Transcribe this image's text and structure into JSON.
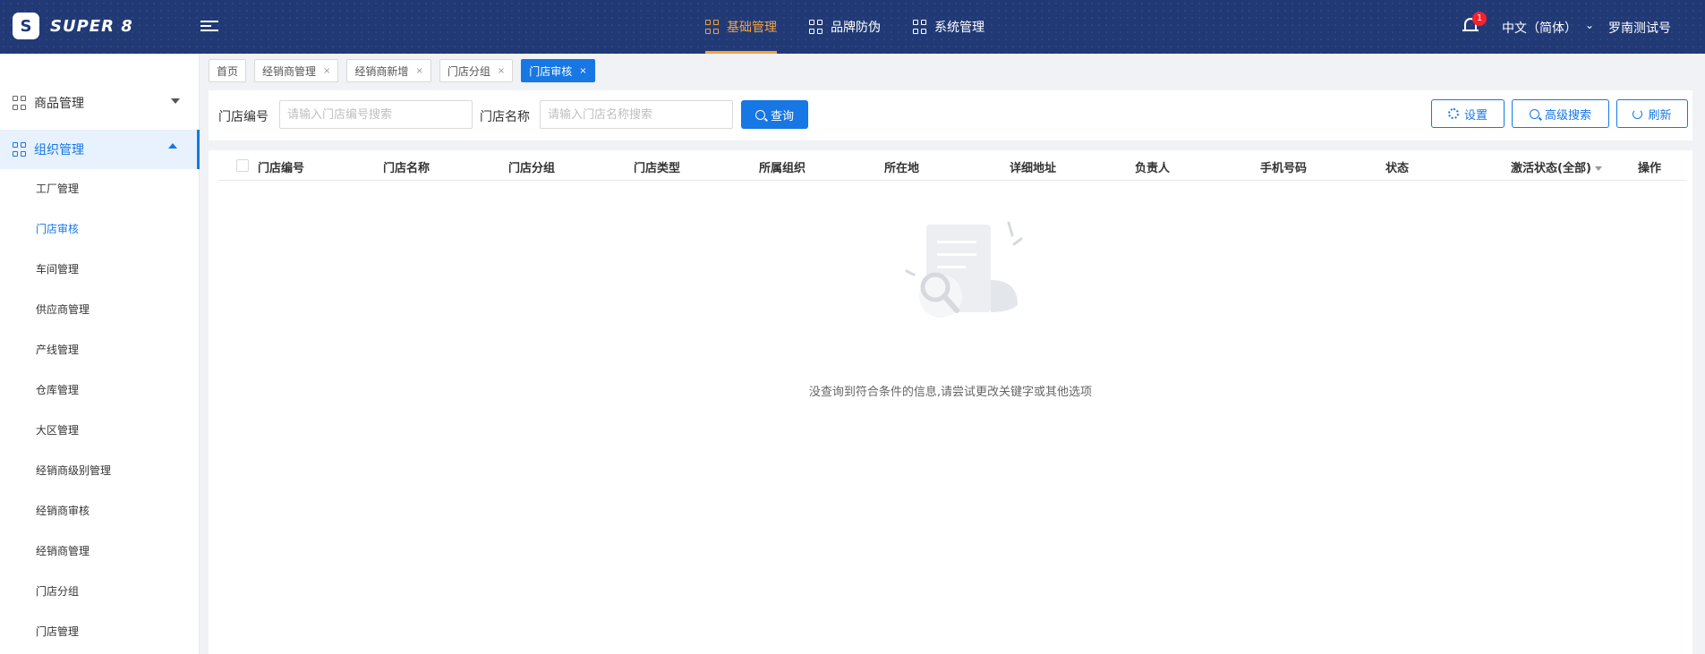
{
  "app": {
    "logo_text": "SUPER 8",
    "logo_mark": "S"
  },
  "topnav": [
    {
      "label": "基础管理",
      "active": true
    },
    {
      "label": "品牌防伪",
      "active": false
    },
    {
      "label": "系统管理",
      "active": false
    }
  ],
  "header": {
    "notification_count": "1",
    "language": "中文（简体）",
    "user": "罗南测试号"
  },
  "sidebar": {
    "groups": [
      {
        "label": "商品管理",
        "expanded": false
      },
      {
        "label": "组织管理",
        "expanded": true
      }
    ],
    "items": [
      {
        "label": "工厂管理",
        "active": false
      },
      {
        "label": "门店审核",
        "active": true
      },
      {
        "label": "车间管理",
        "active": false
      },
      {
        "label": "供应商管理",
        "active": false
      },
      {
        "label": "产线管理",
        "active": false
      },
      {
        "label": "仓库管理",
        "active": false
      },
      {
        "label": "大区管理",
        "active": false
      },
      {
        "label": "经销商级别管理",
        "active": false
      },
      {
        "label": "经销商审核",
        "active": false
      },
      {
        "label": "经销商管理",
        "active": false
      },
      {
        "label": "门店分组",
        "active": false
      },
      {
        "label": "门店管理",
        "active": false
      }
    ]
  },
  "tabs": [
    {
      "label": "首页",
      "closable": false,
      "active": false
    },
    {
      "label": "经销商管理",
      "closable": true,
      "active": false
    },
    {
      "label": "经销商新增",
      "closable": true,
      "active": false
    },
    {
      "label": "门店分组",
      "closable": true,
      "active": false
    },
    {
      "label": "门店审核",
      "closable": true,
      "active": true
    }
  ],
  "search": {
    "store_code_label": "门店编号",
    "store_code_placeholder": "请输入门店编号搜索",
    "store_name_label": "门店名称",
    "store_name_placeholder": "请输入门店名称搜索",
    "query_label": "查询",
    "settings_label": "设置",
    "advanced_label": "高级搜索",
    "refresh_label": "刷新"
  },
  "table": {
    "columns": [
      "门店编号",
      "门店名称",
      "门店分组",
      "门店类型",
      "所属组织",
      "所在地",
      "详细地址",
      "负责人",
      "手机号码",
      "状态",
      "激活状态(全部)",
      "操作"
    ],
    "rows": [],
    "empty_text": "没查询到符合条件的信息,请尝试更改关键字或其他选项"
  },
  "colors": {
    "header_bg": "#213a76",
    "accent": "#1677e5",
    "active_nav": "#f7a23b"
  }
}
